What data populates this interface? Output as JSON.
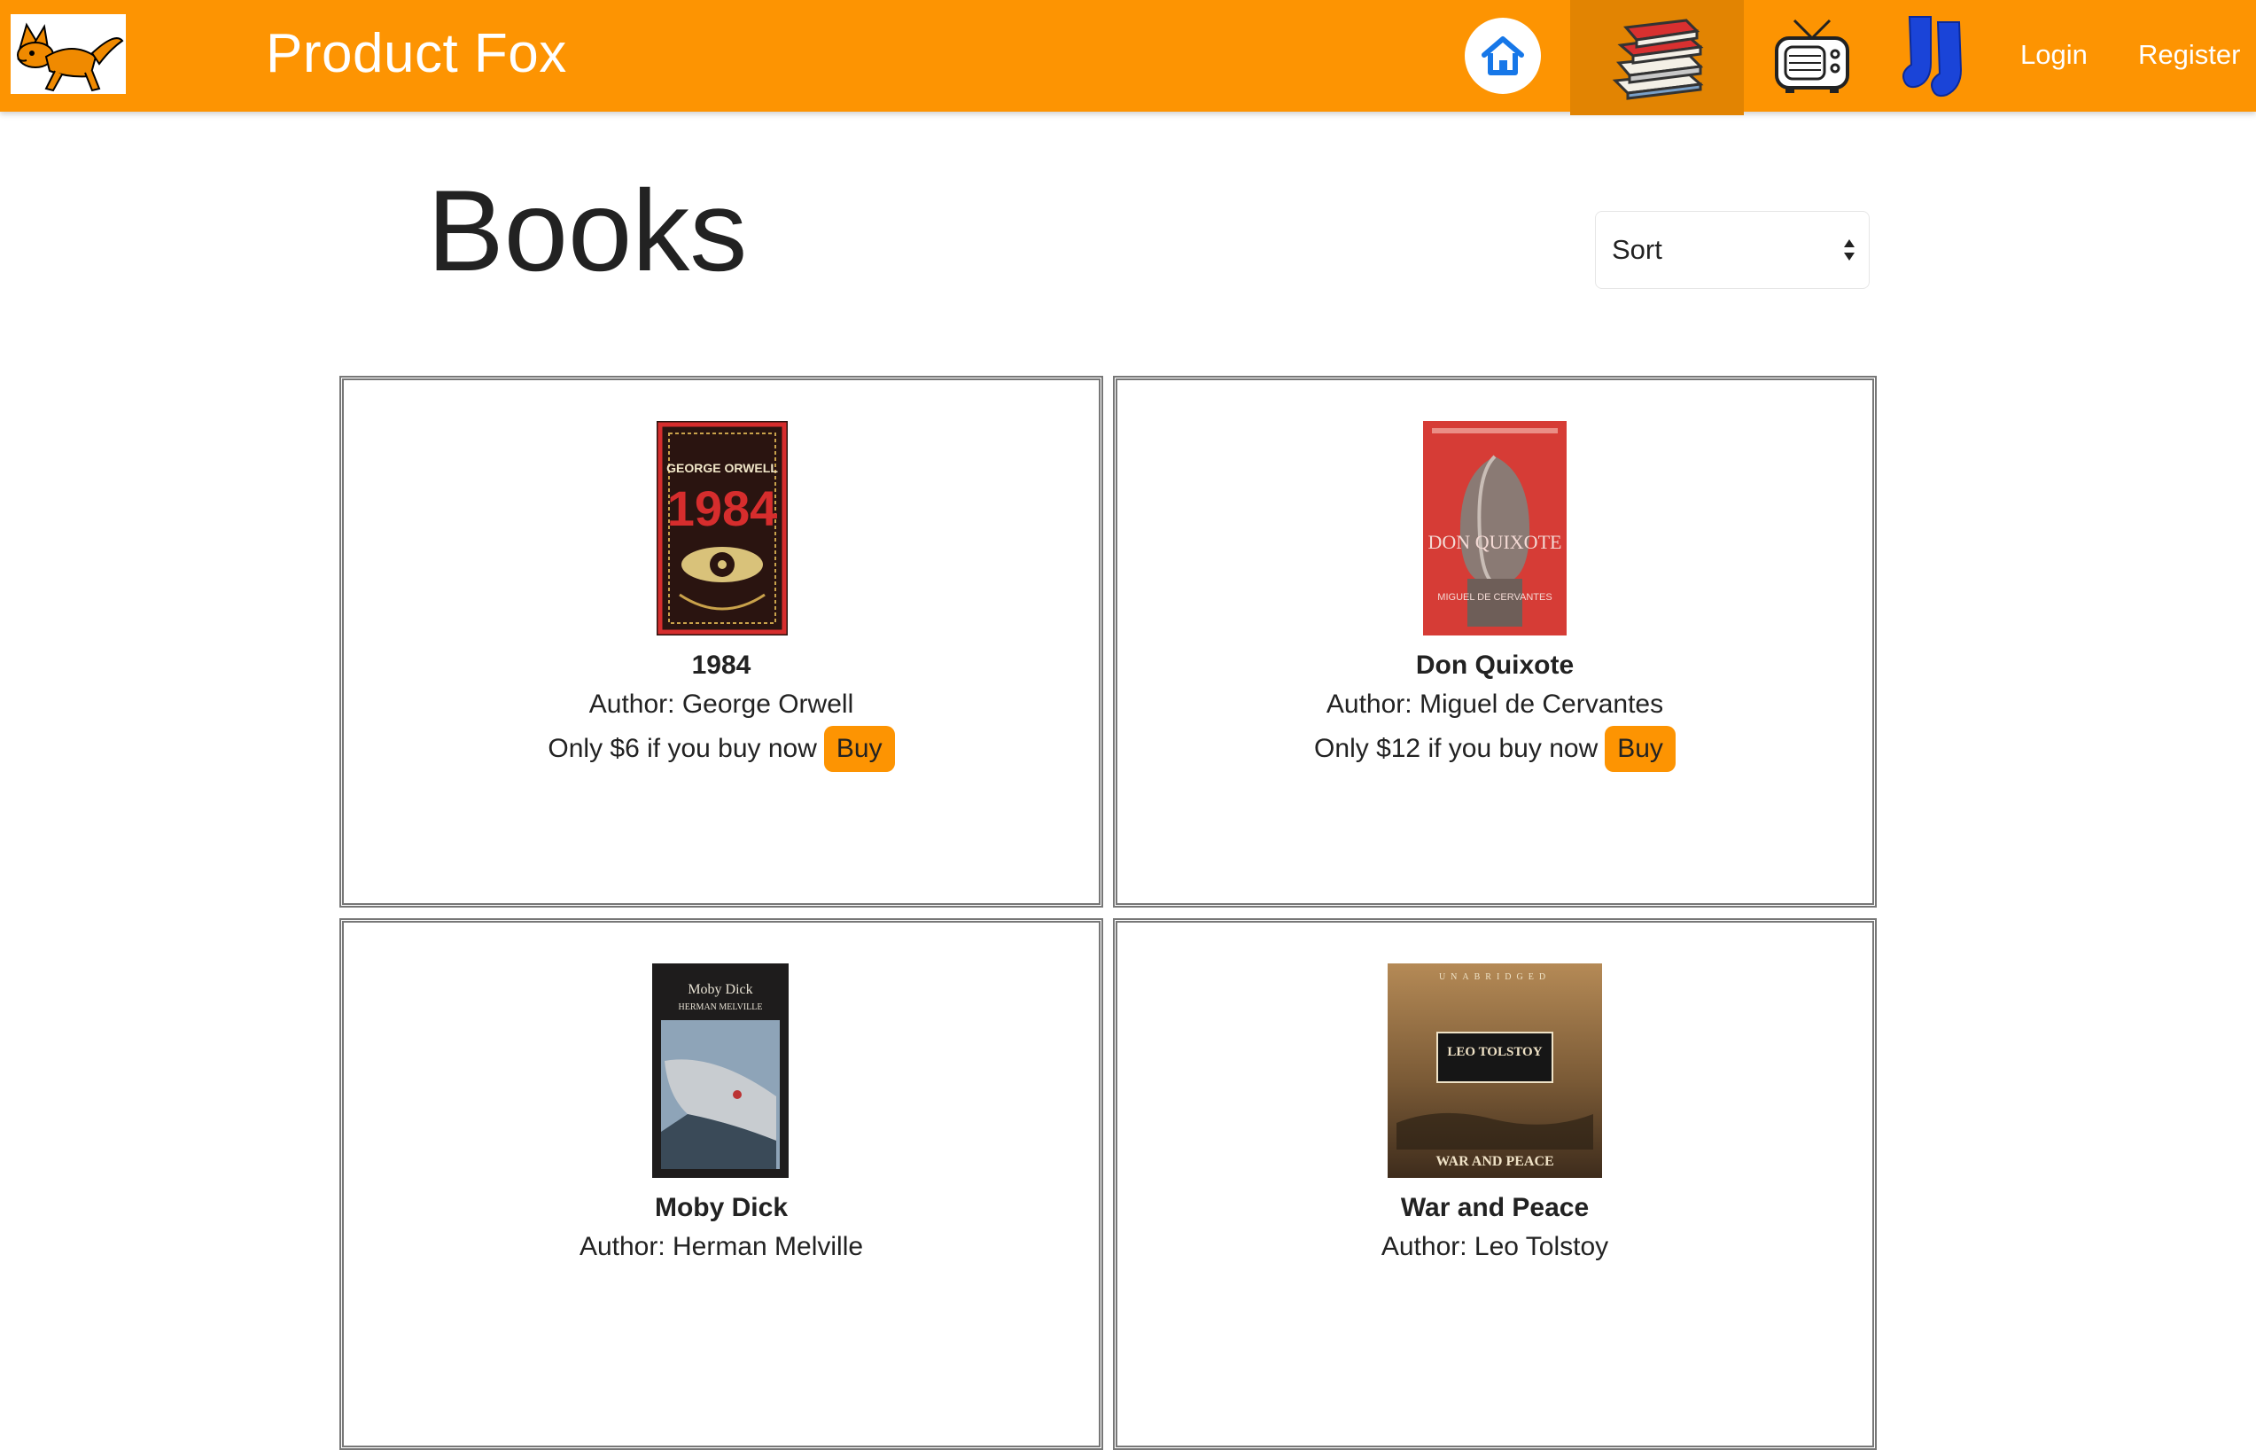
{
  "header": {
    "brand": "Product Fox",
    "login": "Login",
    "register": "Register",
    "icons": [
      "fox-logo",
      "home-icon",
      "books-icon",
      "tv-icon",
      "socks-icon"
    ],
    "accent_color": "#fd9402",
    "active_section": "books"
  },
  "page": {
    "title": "Books",
    "sort": {
      "selected": "Sort"
    }
  },
  "products": [
    {
      "title": "1984",
      "author": "Author: George Orwell",
      "price": "Only $6 if you buy now",
      "buy": "Buy",
      "cover_lines": [
        "GEORGE ORWELL",
        "1984"
      ]
    },
    {
      "title": "Don Quixote",
      "author": "Author: Miguel de Cervantes",
      "price": "Only $12 if you buy now",
      "buy": "Buy",
      "cover_lines": [
        "DON QUIXOTE",
        "MIGUEL DE CERVANTES"
      ]
    },
    {
      "title": "Moby Dick",
      "author": "Author: Herman Melville",
      "price": "",
      "buy": "",
      "cover_lines": [
        "Moby Dick",
        "HERMAN MELVILLE"
      ]
    },
    {
      "title": "War and Peace",
      "author": "Author: Leo Tolstoy",
      "price": "",
      "buy": "",
      "cover_lines": [
        "UNABRIDGED",
        "LEO TOLSTOY",
        "WAR AND PEACE"
      ]
    }
  ]
}
